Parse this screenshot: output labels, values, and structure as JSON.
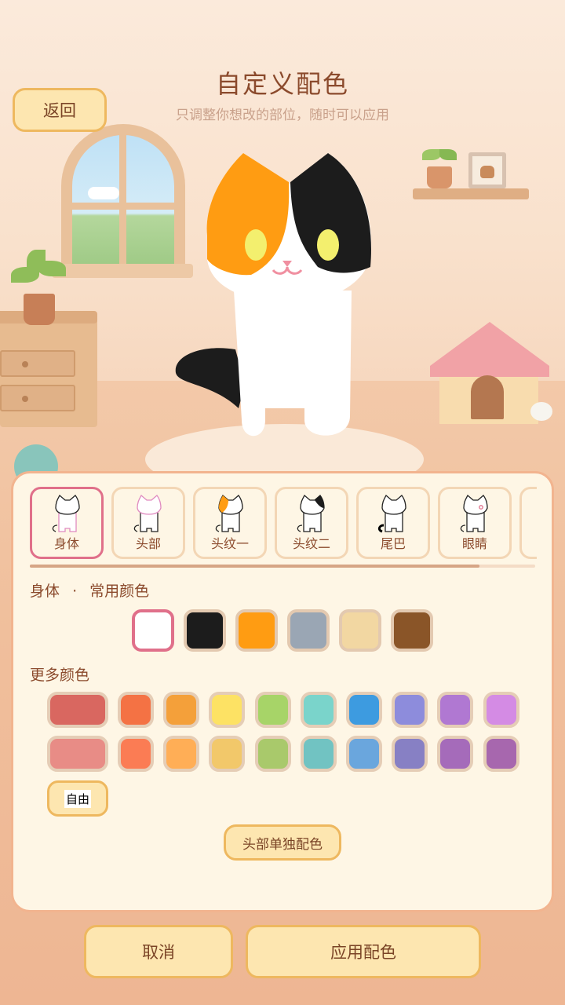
{
  "header": {
    "title": "自定义配色",
    "subtitle": "只调整你想改的部位，随时可以应用",
    "back_label": "返回"
  },
  "parts": [
    {
      "label": "身体",
      "name": "body",
      "selected": true
    },
    {
      "label": "头部",
      "name": "head",
      "selected": false
    },
    {
      "label": "头纹一",
      "name": "head-pattern-1",
      "selected": false
    },
    {
      "label": "头纹二",
      "name": "head-pattern-2",
      "selected": false
    },
    {
      "label": "尾巴",
      "name": "tail",
      "selected": false
    },
    {
      "label": "眼睛",
      "name": "eyes",
      "selected": false
    }
  ],
  "common": {
    "part": "身体",
    "separator": "·",
    "heading": "常用颜色",
    "colors": [
      "#ffffff",
      "#1c1c1c",
      "#ff9c12",
      "#9aa6b4",
      "#f2d7a2",
      "#8a5528"
    ],
    "selected_index": 0
  },
  "more": {
    "heading": "更多颜色",
    "row1": [
      "#d96760",
      "#f47244",
      "#f4a03a",
      "#fde264",
      "#a7d468",
      "#7ad4cb",
      "#3d9be0",
      "#8d8cdc",
      "#b078d2",
      "#d48be4"
    ],
    "row2": [
      "#e88c86",
      "#fb7c54",
      "#ffae56",
      "#f2c86a",
      "#a9c96b",
      "#71c3c2",
      "#6aa6dd",
      "#8780c4",
      "#a56bba",
      "#a767ae"
    ]
  },
  "free_label": "自由",
  "head_separate_label": "头部单独配色",
  "cancel_label": "取消",
  "apply_label": "应用配色",
  "cat": {
    "body_color": "#ffffff",
    "patch1_color": "#ff9c12",
    "patch2_color": "#1c1c1c",
    "eye_color": "#f3ef6e",
    "nose_color": "#f08fa0"
  },
  "tab_scroll_fraction": 0.89
}
